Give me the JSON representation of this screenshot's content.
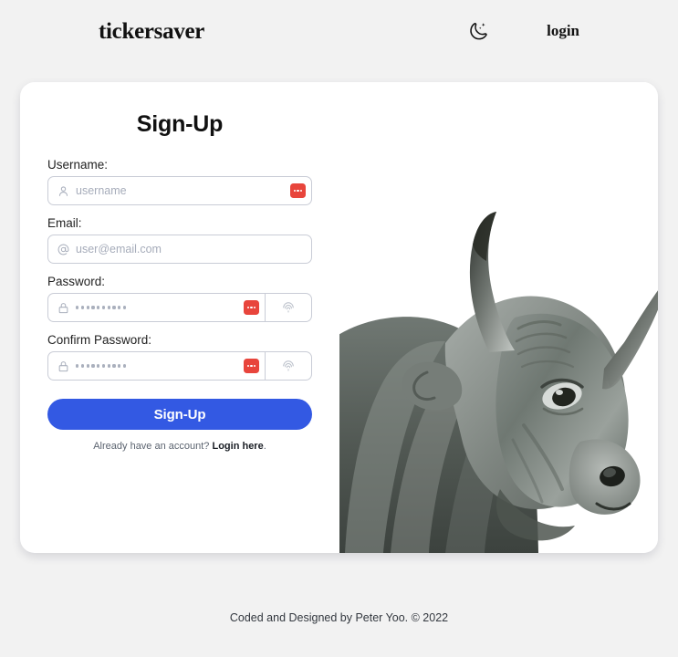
{
  "header": {
    "brand": "tickersaver",
    "theme_toggle_icon": "moon-stars-icon",
    "login_label": "login"
  },
  "card": {
    "form": {
      "title": "Sign-Up",
      "fields": [
        {
          "label": "Username:",
          "icon": "person-icon",
          "placeholder": "username",
          "type": "text",
          "value": "",
          "password_manager_badge": true,
          "biometric_button": false
        },
        {
          "label": "Email:",
          "icon": "at-sign-icon",
          "placeholder": "user@email.com",
          "type": "email",
          "value": "",
          "password_manager_badge": false,
          "biometric_button": false
        },
        {
          "label": "Password:",
          "icon": "lock-icon",
          "placeholder": "••••••••••",
          "type": "password",
          "value": "",
          "password_manager_badge": true,
          "biometric_button": true
        },
        {
          "label": "Confirm Password:",
          "icon": "lock-icon",
          "placeholder": "••••••••••",
          "type": "password",
          "value": "",
          "password_manager_badge": true,
          "biometric_button": true
        }
      ],
      "submit_label": "Sign-Up",
      "alt_prefix": "Already have an account? ",
      "alt_link": "Login here",
      "alt_suffix": "."
    },
    "image": {
      "alt": "bull-statue-photo",
      "description": "Grayscale photograph of a bull statue head with long horns"
    }
  },
  "footer": {
    "text": "Coded and Designed by Peter Yoo. © 2022"
  },
  "colors": {
    "page_background": "#f2f2f2",
    "card_background": "#ffffff",
    "accent_button": "#3359e3",
    "password_manager_badge": "#e8453c",
    "input_border": "#c9ccd6",
    "placeholder_text": "#a6acba"
  }
}
